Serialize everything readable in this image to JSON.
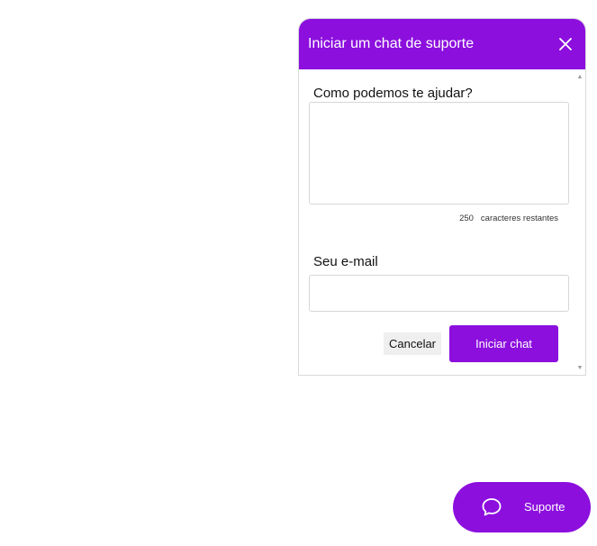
{
  "chat": {
    "title": "Iniciar um chat de suporte",
    "question_label": "Como podemos te ajudar?",
    "message_value": "",
    "chars_remaining": "250",
    "chars_remaining_label": "caracteres restantes",
    "email_label": "Seu e-mail",
    "email_value": "",
    "cancel_label": "Cancelar",
    "start_label": "Iniciar chat"
  },
  "support_button": {
    "label": "Suporte",
    "icon": "chat-bubble-icon"
  },
  "colors": {
    "brand": "#8c0fde",
    "background": "#ffffff"
  }
}
